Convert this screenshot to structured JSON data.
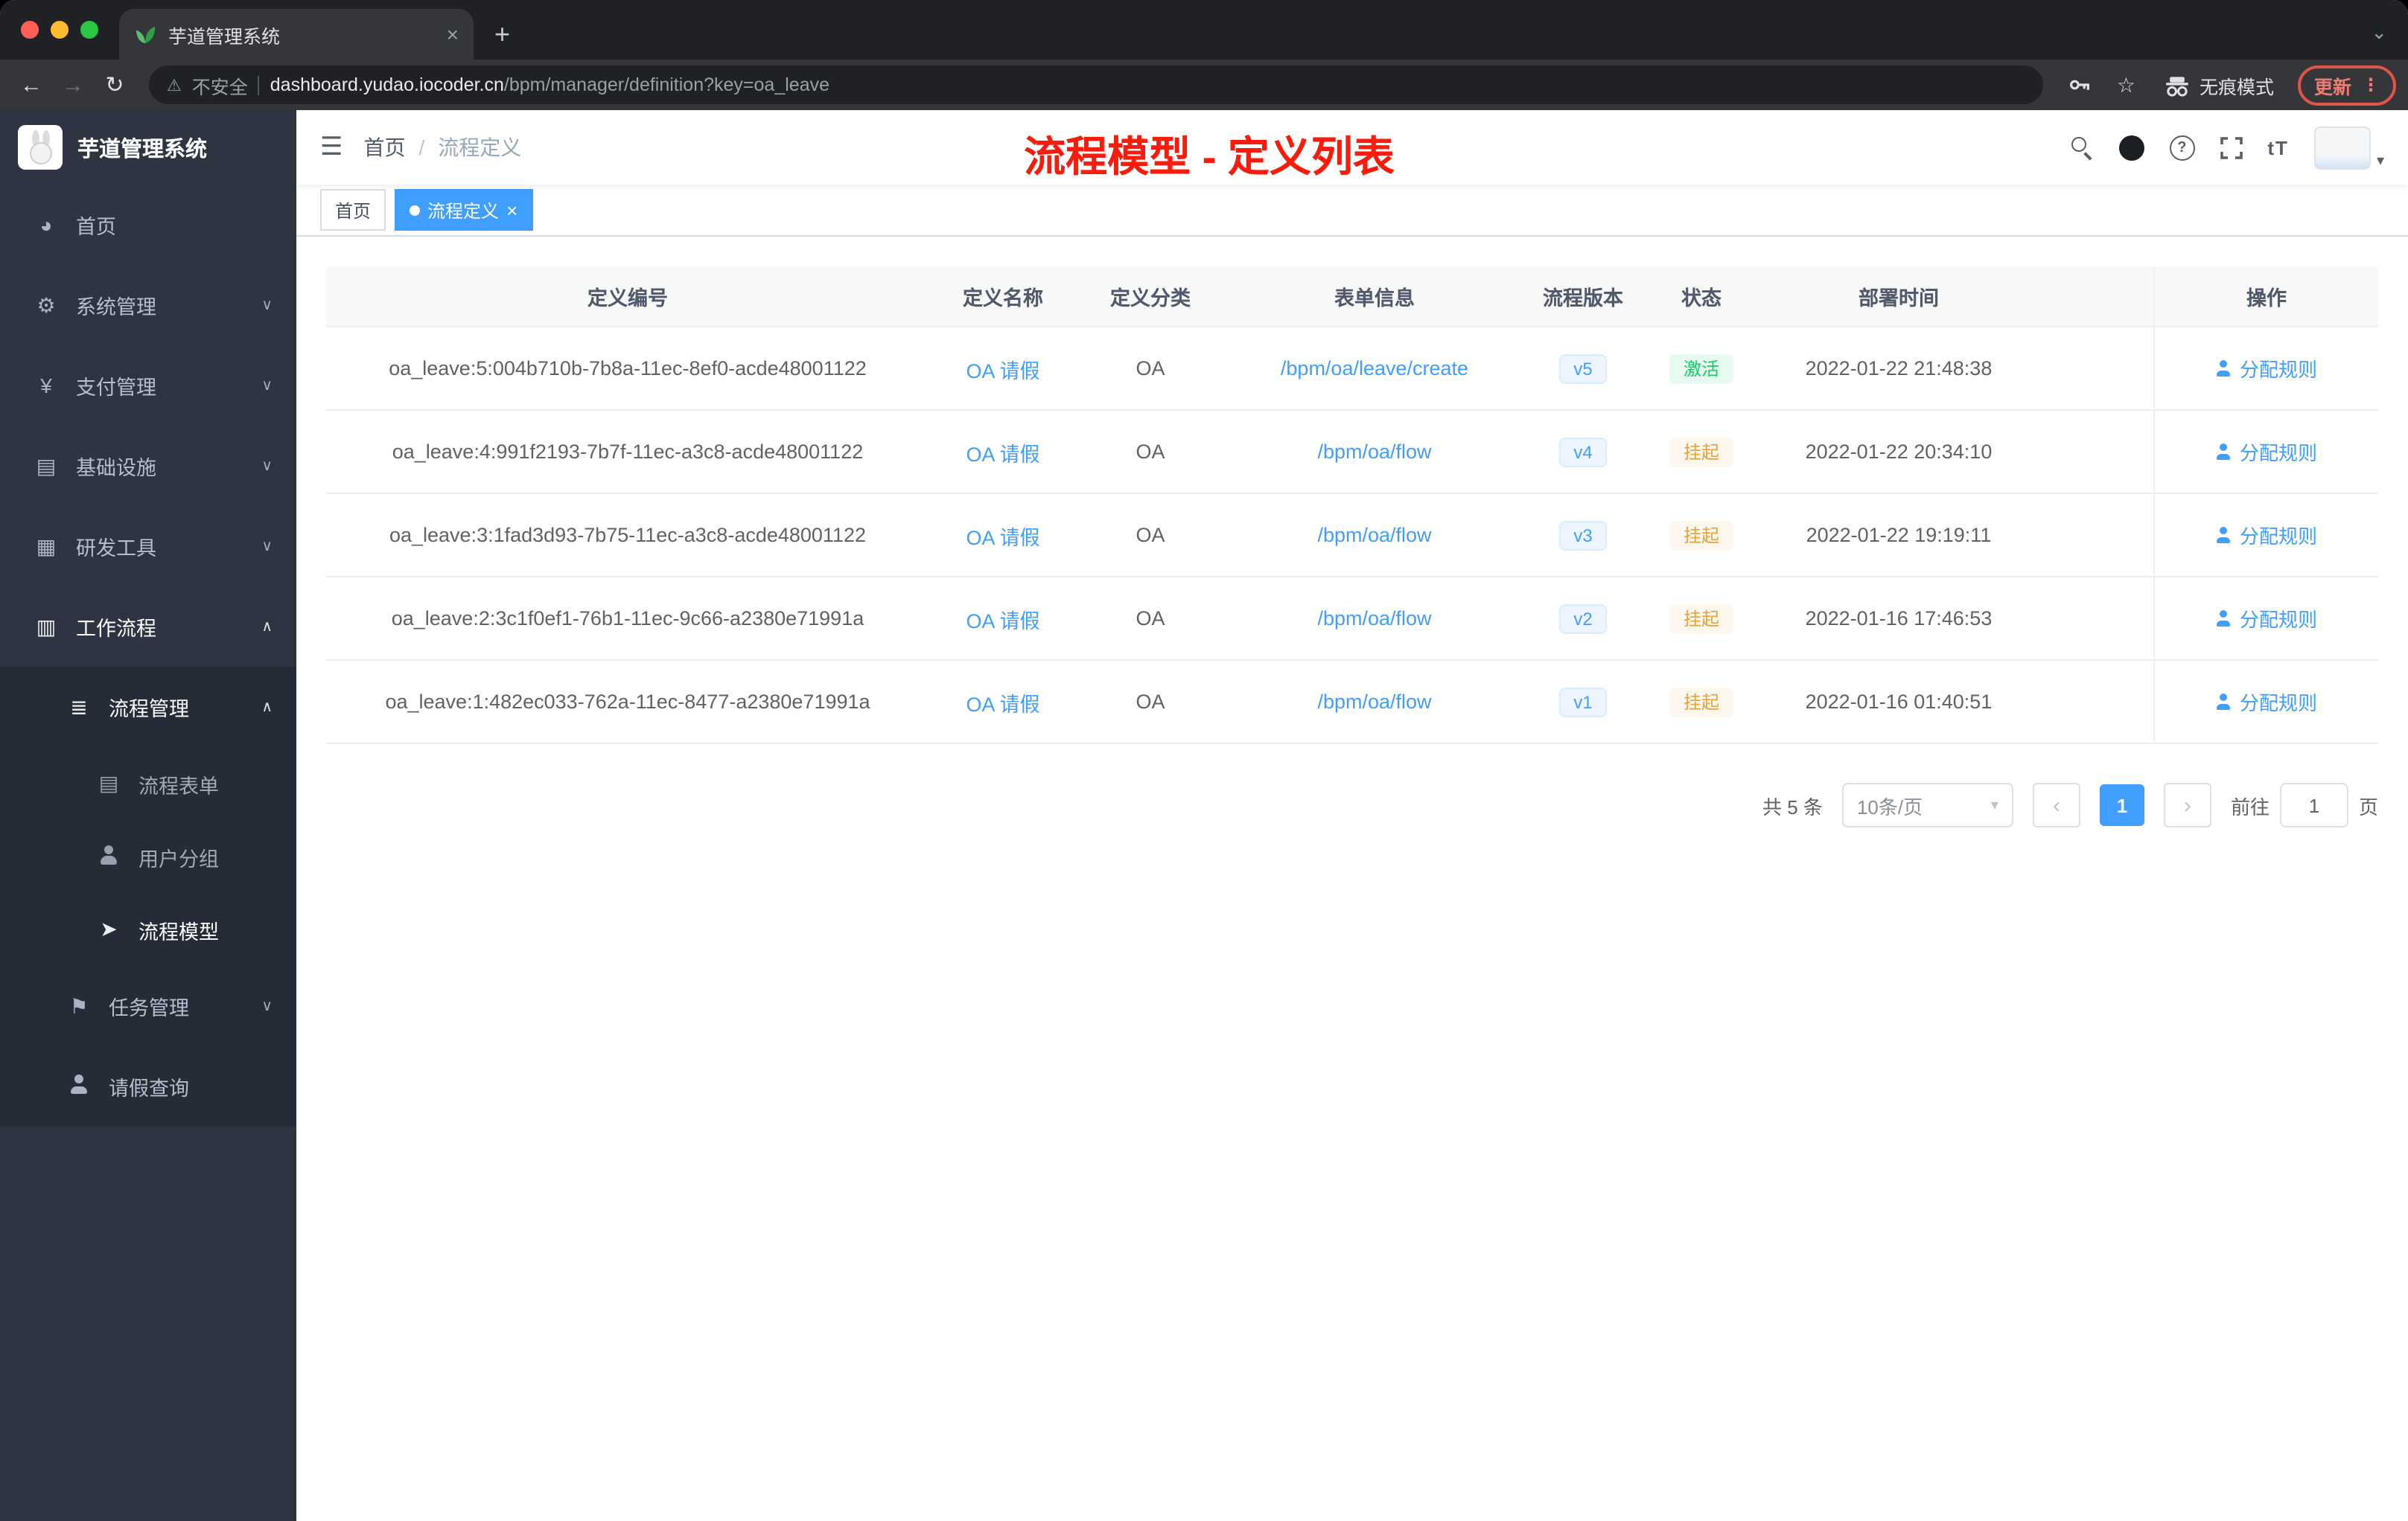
{
  "browser": {
    "tab_title": "芋道管理系统",
    "tab_close": "×",
    "new_tab": "+",
    "tab_search_caret": "⌄",
    "back": "←",
    "forward": "→",
    "reload": "↻",
    "security_icon": "⚠",
    "security_label": "不安全",
    "url_domain": "dashboard.yudao.iocoder.cn",
    "url_path": "/bpm/manager/definition?key=oa_leave",
    "star": "☆",
    "incognito_label": "无痕模式",
    "update_label": "更新",
    "menu_dots": "⋮"
  },
  "sidebar": {
    "logo_title": "芋道管理系统",
    "items": [
      {
        "label": "首页",
        "icon": "dashboard-icon",
        "glyph": "◕"
      },
      {
        "label": "系统管理",
        "icon": "gear-icon",
        "glyph": "⚙",
        "chevron": "∨"
      },
      {
        "label": "支付管理",
        "icon": "yen-icon",
        "glyph": "¥",
        "chevron": "∨"
      },
      {
        "label": "基础设施",
        "icon": "infrastructure-icon",
        "glyph": "▤",
        "chevron": "∨"
      },
      {
        "label": "研发工具",
        "icon": "dev-tools-icon",
        "glyph": "▦",
        "chevron": "∨"
      },
      {
        "label": "工作流程",
        "icon": "workflow-icon",
        "glyph": "▥",
        "chevron": "∧"
      },
      {
        "label": "流程管理",
        "icon": "process-list-icon",
        "glyph": "≣",
        "chevron": "∧"
      },
      {
        "label": "流程表单",
        "icon": "form-icon",
        "glyph": "▤"
      },
      {
        "label": "用户分组",
        "icon": "user-group-icon",
        "glyph": ""
      },
      {
        "label": "流程模型",
        "icon": "send-icon",
        "glyph": "➤"
      },
      {
        "label": "任务管理",
        "icon": "task-flag-icon",
        "glyph": "⚑",
        "chevron": "∨"
      },
      {
        "label": "请假查询",
        "icon": "user-icon",
        "glyph": ""
      }
    ]
  },
  "navbar": {
    "breadcrumb_home": "首页",
    "breadcrumb_sep": "/",
    "breadcrumb_current": "流程定义",
    "annotation": "流程模型 - 定义列表",
    "font_size_icon": "tT",
    "question_mark": "?",
    "avatar_caret": "▾"
  },
  "tags": {
    "first": "首页",
    "active": "流程定义",
    "close": "×"
  },
  "table": {
    "headers": [
      "定义编号",
      "定义名称",
      "定义分类",
      "表单信息",
      "流程版本",
      "状态",
      "部署时间",
      "操作"
    ],
    "rows": [
      {
        "id": "oa_leave:5:004b710b-7b8a-11ec-8ef0-acde48001122",
        "name": "OA 请假",
        "category": "OA",
        "form": "/bpm/oa/leave/create",
        "version": "v5",
        "status": "激活",
        "status_type": "success",
        "time": "2022-01-22 21:48:38",
        "action": "分配规则"
      },
      {
        "id": "oa_leave:4:991f2193-7b7f-11ec-a3c8-acde48001122",
        "name": "OA 请假",
        "category": "OA",
        "form": "/bpm/oa/flow",
        "version": "v4",
        "status": "挂起",
        "status_type": "warning",
        "time": "2022-01-22 20:34:10",
        "action": "分配规则"
      },
      {
        "id": "oa_leave:3:1fad3d93-7b75-11ec-a3c8-acde48001122",
        "name": "OA 请假",
        "category": "OA",
        "form": "/bpm/oa/flow",
        "version": "v3",
        "status": "挂起",
        "status_type": "warning",
        "time": "2022-01-22 19:19:11",
        "action": "分配规则"
      },
      {
        "id": "oa_leave:2:3c1f0ef1-76b1-11ec-9c66-a2380e71991a",
        "name": "OA 请假",
        "category": "OA",
        "form": "/bpm/oa/flow",
        "version": "v2",
        "status": "挂起",
        "status_type": "warning",
        "time": "2022-01-16 17:46:53",
        "action": "分配规则"
      },
      {
        "id": "oa_leave:1:482ec033-762a-11ec-8477-a2380e71991a",
        "name": "OA 请假",
        "category": "OA",
        "form": "/bpm/oa/flow",
        "version": "v1",
        "status": "挂起",
        "status_type": "warning",
        "time": "2022-01-16 01:40:51",
        "action": "分配规则"
      }
    ]
  },
  "pagination": {
    "total": "共 5 条",
    "page_size": "10条/页",
    "size_caret": "▾",
    "prev": "‹",
    "page": "1",
    "next": "›",
    "goto_label": "前往",
    "goto_value": "1",
    "page_unit": "页"
  },
  "colors": {
    "accent": "#409eff",
    "annotation_red": "#f91c0c",
    "status_success": "#13ce66",
    "status_warning": "#e6a23c",
    "sidebar_bg": "#2e3442"
  }
}
